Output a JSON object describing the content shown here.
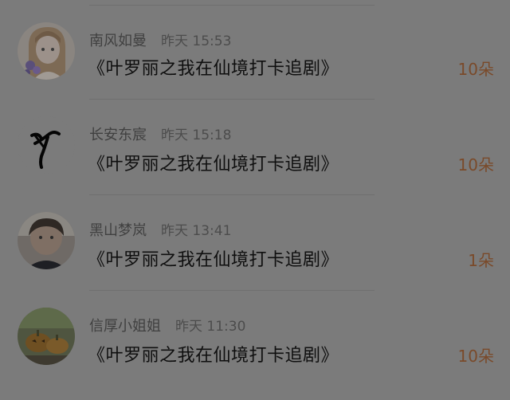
{
  "items": [
    {
      "name": "南风如曼",
      "time": "昨天 15:53",
      "title": "《叶罗丽之我在仙境打卡追剧》",
      "count": "10朵",
      "avatar": "anime-girl-flowers-avatar"
    },
    {
      "name": "长安东宸",
      "time": "昨天 15:18",
      "title": "《叶罗丽之我在仙境打卡追剧》",
      "count": "10朵",
      "avatar": "ink-figure-avatar"
    },
    {
      "name": "黑山梦岚",
      "time": "昨天 13:41",
      "title": "《叶罗丽之我在仙境打卡追剧》",
      "count": "1朵",
      "avatar": "child-photo-avatar"
    },
    {
      "name": "信厚小姐姐",
      "time": "昨天 11:30",
      "title": "《叶罗丽之我在仙境打卡追剧》",
      "count": "10朵",
      "avatar": "pumpkin-photo-avatar"
    }
  ],
  "colors": {
    "background": "#7b7b7b",
    "count": "#7a4a2a",
    "title": "#0f0f0f",
    "meta": "#4a4a4a"
  }
}
